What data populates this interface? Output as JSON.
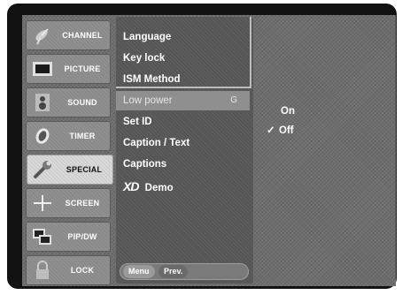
{
  "categories": [
    {
      "label": "CHANNEL",
      "icon": "satellite-dish-icon",
      "active": false
    },
    {
      "label": "PICTURE",
      "icon": "monitor-icon",
      "active": false
    },
    {
      "label": "SOUND",
      "icon": "speaker-icon",
      "active": false
    },
    {
      "label": "TIMER",
      "icon": "clock-icon",
      "active": false
    },
    {
      "label": "SPECIAL",
      "icon": "wrench-icon",
      "active": true
    },
    {
      "label": "SCREEN",
      "icon": "crosshair-icon",
      "active": false
    },
    {
      "label": "PIP/DW",
      "icon": "pip-windows-icon",
      "active": false
    },
    {
      "label": "LOCK",
      "icon": "padlock-icon",
      "active": false
    }
  ],
  "submenu": {
    "items": [
      {
        "label": "Language"
      },
      {
        "label": "Key lock"
      },
      {
        "label": "ISM Method"
      },
      {
        "label": "Low power",
        "hotkey": "G",
        "selected": true
      },
      {
        "label": "Set ID"
      },
      {
        "label": "Caption / Text"
      },
      {
        "label": "Captions"
      },
      {
        "label": "Demo",
        "logo": "XD"
      }
    ],
    "nav": {
      "menu": "Menu",
      "prev": "Prev."
    }
  },
  "options": [
    {
      "label": "On",
      "checked": false
    },
    {
      "label": "Off",
      "checked": true,
      "check_mark": "✓"
    }
  ],
  "colors": {
    "selected_category": "#d9d9d9",
    "selected_item": "#8f8f8f",
    "panel": "#555555"
  }
}
